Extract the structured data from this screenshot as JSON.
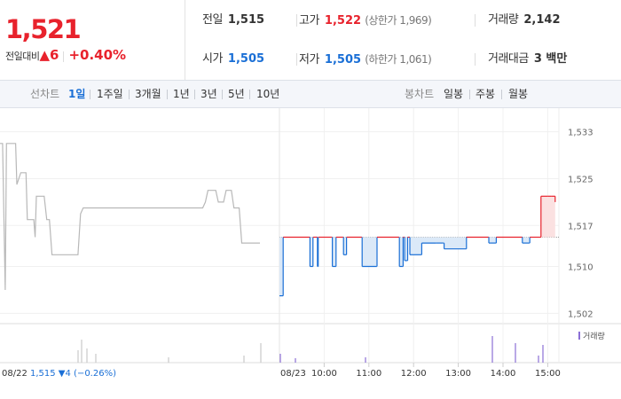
{
  "price": {
    "current": "1,521",
    "change_label": "전일대비",
    "change_arrow": "▲",
    "change_value": "6",
    "change_pct": "+0.40%"
  },
  "summary": {
    "prev_close": {
      "label": "전일",
      "value": "1,515"
    },
    "high": {
      "label": "고가",
      "value": "1,522",
      "sub": "(상한가 1,969)"
    },
    "volume": {
      "label": "거래량",
      "value": "2,142"
    },
    "open": {
      "label": "시가",
      "value": "1,505"
    },
    "low": {
      "label": "저가",
      "value": "1,505",
      "sub": "(하한가 1,061)"
    },
    "amount": {
      "label": "거래대금",
      "value": "3 백만"
    }
  },
  "tabs": {
    "line_label": "선차트",
    "line": [
      "1일",
      "1주일",
      "3개월",
      "1년",
      "3년",
      "5년",
      "10년"
    ],
    "line_active": "1일",
    "candle_label": "봉차트",
    "candle": [
      "일봉",
      "주봉",
      "월봉"
    ]
  },
  "chart_data": {
    "type": "line",
    "y_ticks": [
      "1,533",
      "1,525",
      "1,517",
      "1,510",
      "1,502"
    ],
    "ylim": [
      1501,
      1534
    ],
    "prev_close": 1515,
    "prev_day": {
      "date": "08/22",
      "summary": "1,515 ▼4 (−0.26%)",
      "points": [
        [
          0,
          1531
        ],
        [
          0.01,
          1531
        ],
        [
          0.02,
          1506
        ],
        [
          0.025,
          1531
        ],
        [
          0.06,
          1531
        ],
        [
          0.065,
          1524
        ],
        [
          0.08,
          1526
        ],
        [
          0.1,
          1526
        ],
        [
          0.105,
          1518
        ],
        [
          0.13,
          1518
        ],
        [
          0.135,
          1515
        ],
        [
          0.14,
          1522
        ],
        [
          0.17,
          1522
        ],
        [
          0.18,
          1518
        ],
        [
          0.19,
          1518
        ],
        [
          0.2,
          1512
        ],
        [
          0.3,
          1512
        ],
        [
          0.31,
          1519
        ],
        [
          0.32,
          1520
        ],
        [
          0.4,
          1520
        ],
        [
          0.5,
          1520
        ],
        [
          0.6,
          1520
        ],
        [
          0.7,
          1520
        ],
        [
          0.78,
          1520
        ],
        [
          0.79,
          1521
        ],
        [
          0.8,
          1523
        ],
        [
          0.83,
          1523
        ],
        [
          0.84,
          1521
        ],
        [
          0.86,
          1521
        ],
        [
          0.87,
          1523
        ],
        [
          0.89,
          1523
        ],
        [
          0.9,
          1520
        ],
        [
          0.92,
          1520
        ],
        [
          0.93,
          1514
        ],
        [
          0.95,
          1514
        ],
        [
          0.96,
          1514
        ],
        [
          1.0,
          1514
        ]
      ]
    },
    "today": {
      "date": "08/23",
      "x_ticks": [
        "10:00",
        "11:00",
        "12:00",
        "13:00",
        "14:00",
        "15:00"
      ],
      "points": [
        [
          "09:00",
          1505
        ],
        [
          "09:05",
          1515
        ],
        [
          "09:40",
          1515
        ],
        [
          "09:41",
          1510
        ],
        [
          "09:44",
          1510
        ],
        [
          "09:45",
          1515
        ],
        [
          "09:50",
          1515
        ],
        [
          "09:51",
          1510
        ],
        [
          "09:52",
          1515
        ],
        [
          "10:10",
          1515
        ],
        [
          "10:11",
          1510
        ],
        [
          "10:15",
          1510
        ],
        [
          "10:16",
          1515
        ],
        [
          "10:25",
          1515
        ],
        [
          "10:26",
          1512
        ],
        [
          "10:30",
          1515
        ],
        [
          "10:50",
          1515
        ],
        [
          "10:51",
          1510
        ],
        [
          "11:10",
          1510
        ],
        [
          "11:11",
          1515
        ],
        [
          "11:40",
          1515
        ],
        [
          "11:41",
          1510
        ],
        [
          "11:45",
          1510
        ],
        [
          "11:46",
          1515
        ],
        [
          "11:48",
          1511
        ],
        [
          "11:52",
          1515
        ],
        [
          "11:55",
          1512
        ],
        [
          "12:10",
          1512
        ],
        [
          "12:11",
          1514
        ],
        [
          "12:30",
          1514
        ],
        [
          "12:40",
          1514
        ],
        [
          "12:41",
          1513
        ],
        [
          "13:10",
          1513
        ],
        [
          "13:11",
          1515
        ],
        [
          "13:40",
          1515
        ],
        [
          "13:41",
          1514
        ],
        [
          "13:50",
          1514
        ],
        [
          "13:51",
          1515
        ],
        [
          "14:25",
          1515
        ],
        [
          "14:26",
          1514
        ],
        [
          "14:35",
          1514
        ],
        [
          "14:36",
          1515
        ],
        [
          "14:50",
          1515
        ],
        [
          "14:51",
          1522
        ],
        [
          "15:00",
          1522
        ],
        [
          "15:05",
          1522
        ],
        [
          "15:10",
          1521
        ]
      ]
    },
    "volume_label": "거래량"
  }
}
